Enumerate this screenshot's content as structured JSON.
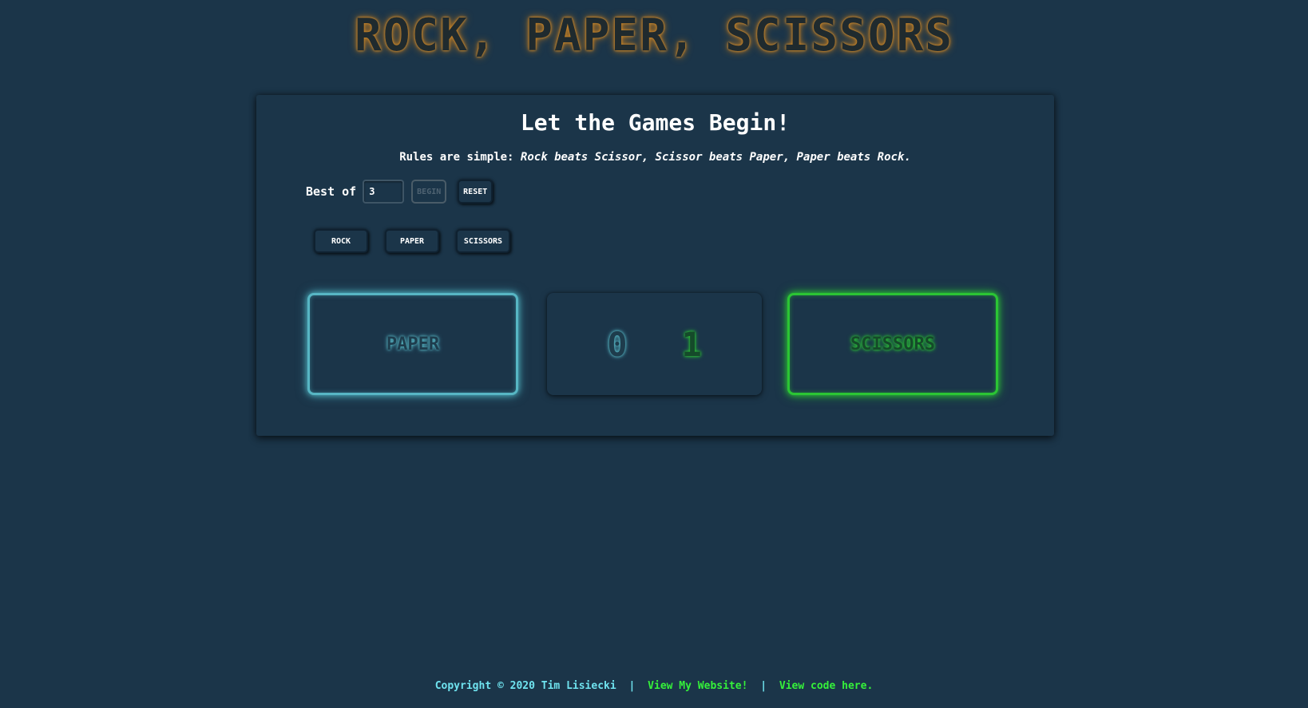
{
  "header": {
    "title": "ROCK, PAPER, SCISSORS"
  },
  "panel": {
    "heading": "Let the Games Begin!",
    "rules_prefix": "Rules are simple:",
    "rules_text": "Rock beats Scissor, Scissor beats Paper, Paper beats Rock."
  },
  "controls": {
    "best_of_label": "Best of",
    "best_of_value": "3",
    "begin_label": "BEGIN",
    "reset_label": "RESET"
  },
  "moves": [
    {
      "label": "ROCK"
    },
    {
      "label": "PAPER"
    },
    {
      "label": "SCISSORS"
    }
  ],
  "game": {
    "player_choice": "PAPER",
    "computer_choice": "SCISSORS",
    "player_score": "0",
    "computer_score": "1"
  },
  "footer": {
    "copyright": "Copyright © 2020 Tim Lisiecki",
    "separator": "|",
    "website_link": "View My Website!",
    "code_link": "View code here."
  },
  "colors": {
    "background": "#1b3549",
    "title_glow": "#c9862a",
    "player_accent": "#57b6c4",
    "computer_accent": "#2bc534",
    "footer_text": "#6fe3ef",
    "footer_link": "#35f13a"
  }
}
